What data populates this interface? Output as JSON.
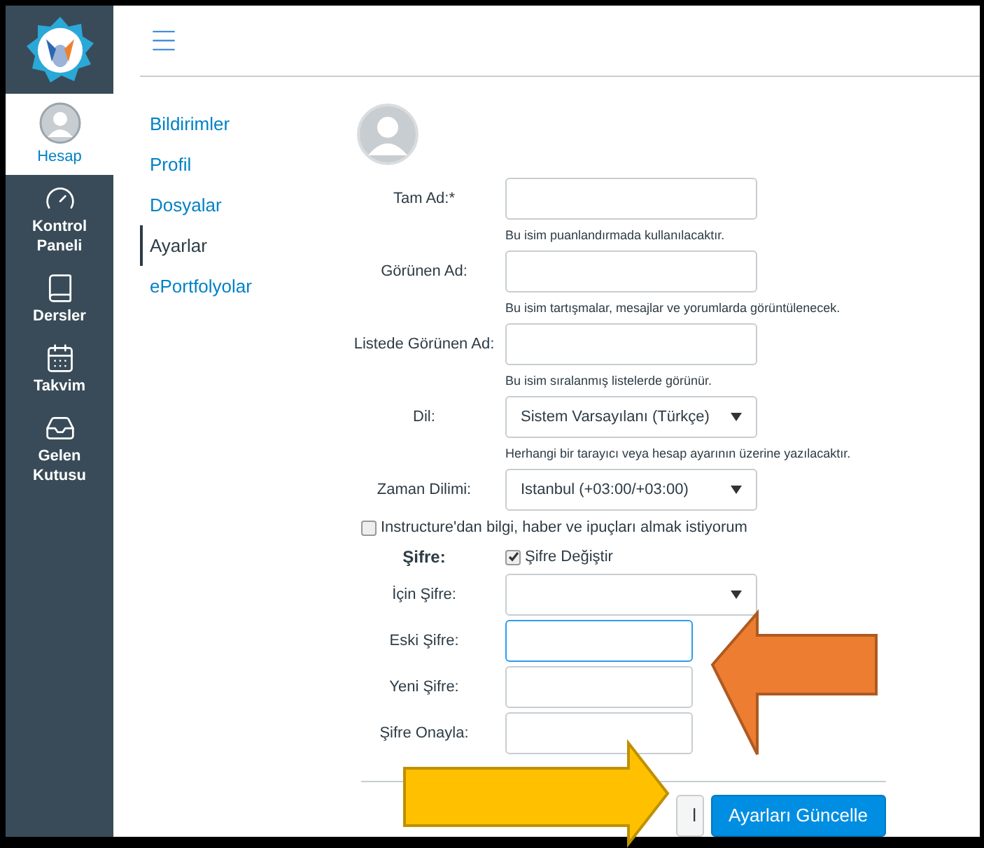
{
  "sidebar": {
    "items": [
      {
        "label": "Hesap",
        "kind": "avatar",
        "selected": true
      },
      {
        "label": "Kontrol Paneli",
        "kind": "gauge",
        "selected": false
      },
      {
        "label": "Dersler",
        "kind": "book",
        "selected": false
      },
      {
        "label": "Takvim",
        "kind": "calendar",
        "selected": false
      },
      {
        "label": "Gelen Kutusu",
        "kind": "inbox",
        "selected": false
      }
    ]
  },
  "nav": [
    {
      "label": "Bildirimler",
      "selected": false
    },
    {
      "label": "Profil",
      "selected": false
    },
    {
      "label": "Dosyalar",
      "selected": false
    },
    {
      "label": "Ayarlar",
      "selected": true
    },
    {
      "label": "ePortfolyolar",
      "selected": false
    }
  ],
  "fields": [
    {
      "kind": "text",
      "label": "Tam Ad:*",
      "hint": "Bu isim puanlandırmada kullanılacaktır."
    },
    {
      "kind": "text",
      "label": "Görünen Ad:",
      "hint": "Bu isim tartışmalar, mesajlar ve yorumlarda görüntülenecek."
    },
    {
      "kind": "text",
      "label": "Listede Görünen Ad:",
      "hint": "Bu isim sıralanmış listelerde görünür."
    },
    {
      "kind": "select",
      "label": "Dil:",
      "value": "Sistem Varsayılanı (Türkçe)",
      "hint": "Herhangi bir tarayıcı veya hesap ayarının üzerine yazılacaktır."
    },
    {
      "kind": "select",
      "label": "Zaman Dilimi:",
      "value": "Istanbul (+03:00/+03:00)"
    }
  ],
  "newsletter": {
    "label": "Instructure'dan bilgi, haber ve ipuçları almak istiyorum",
    "checked": false
  },
  "password": {
    "label": "Şifre:",
    "change": {
      "label": "Şifre Değiştir",
      "checked": true
    },
    "fields": [
      {
        "kind": "select",
        "label": "İçin Şifre:",
        "focused": false
      },
      {
        "kind": "text",
        "label": "Eski Şifre:",
        "focused": true
      },
      {
        "kind": "text",
        "label": "Yeni Şifre:",
        "focused": false
      },
      {
        "kind": "text",
        "label": "Şifre Onayla:",
        "focused": false
      }
    ]
  },
  "buttons": {
    "cancel": "l",
    "submit": "Ayarları Güncelle"
  }
}
